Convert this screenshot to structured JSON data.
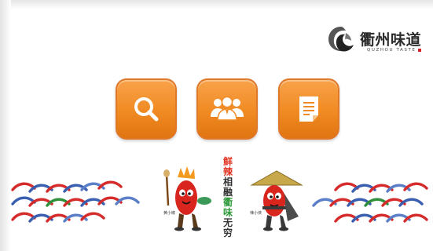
{
  "logo": {
    "title": "衢州味道",
    "subtitle": "QUZHOU TASTE"
  },
  "tiles": [
    {
      "icon": "search-icon",
      "label": ""
    },
    {
      "icon": "users-icon",
      "label": ""
    },
    {
      "icon": "document-icon",
      "label": ""
    }
  ],
  "banner": {
    "slogan_chars": [
      "鲜",
      "辣",
      "相",
      "融",
      "衢",
      "味",
      "无",
      "穷"
    ],
    "left_mascot_sign": "黄小椒",
    "right_mascot_sign": "辣小侠"
  },
  "colors": {
    "tile_orange": "#f08a22",
    "slogan_red": "#e0301e",
    "slogan_green": "#2f9a3a"
  }
}
